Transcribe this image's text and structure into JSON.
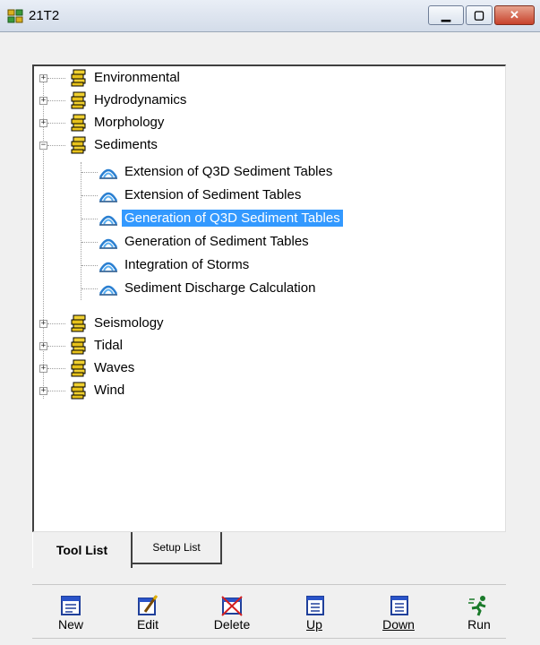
{
  "window": {
    "title": "21T2"
  },
  "tree": {
    "items": [
      {
        "label": "Environmental",
        "type": "folder",
        "expander": "+"
      },
      {
        "label": "Hydrodynamics",
        "type": "folder",
        "expander": "+"
      },
      {
        "label": "Morphology",
        "type": "folder",
        "expander": "+"
      },
      {
        "label": "Sediments",
        "type": "folder",
        "expander": "-"
      },
      {
        "label": "Extension of Q3D Sediment Tables",
        "type": "tool"
      },
      {
        "label": "Extension of Sediment Tables",
        "type": "tool"
      },
      {
        "label": "Generation of Q3D Sediment Tables",
        "type": "tool",
        "selected": true
      },
      {
        "label": "Generation of Sediment Tables",
        "type": "tool"
      },
      {
        "label": "Integration of Storms",
        "type": "tool"
      },
      {
        "label": "Sediment Discharge Calculation",
        "type": "tool"
      },
      {
        "label": "Seismology",
        "type": "folder",
        "expander": "+"
      },
      {
        "label": "Tidal",
        "type": "folder",
        "expander": "+"
      },
      {
        "label": "Waves",
        "type": "folder",
        "expander": "+"
      },
      {
        "label": "Wind",
        "type": "folder",
        "expander": "+"
      }
    ]
  },
  "tabs": [
    {
      "label": "Tool List",
      "active": true
    },
    {
      "label": "Setup List",
      "active": false
    }
  ],
  "toolbar": {
    "new_label": "New",
    "edit_label": "Edit",
    "delete_label": "Delete",
    "up_label": "Up",
    "down_label": "Down",
    "run_label": "Run"
  },
  "colors": {
    "selection": "#3399ff",
    "folder": "#e8c21a",
    "tool_icon": "#2a7fd1"
  }
}
